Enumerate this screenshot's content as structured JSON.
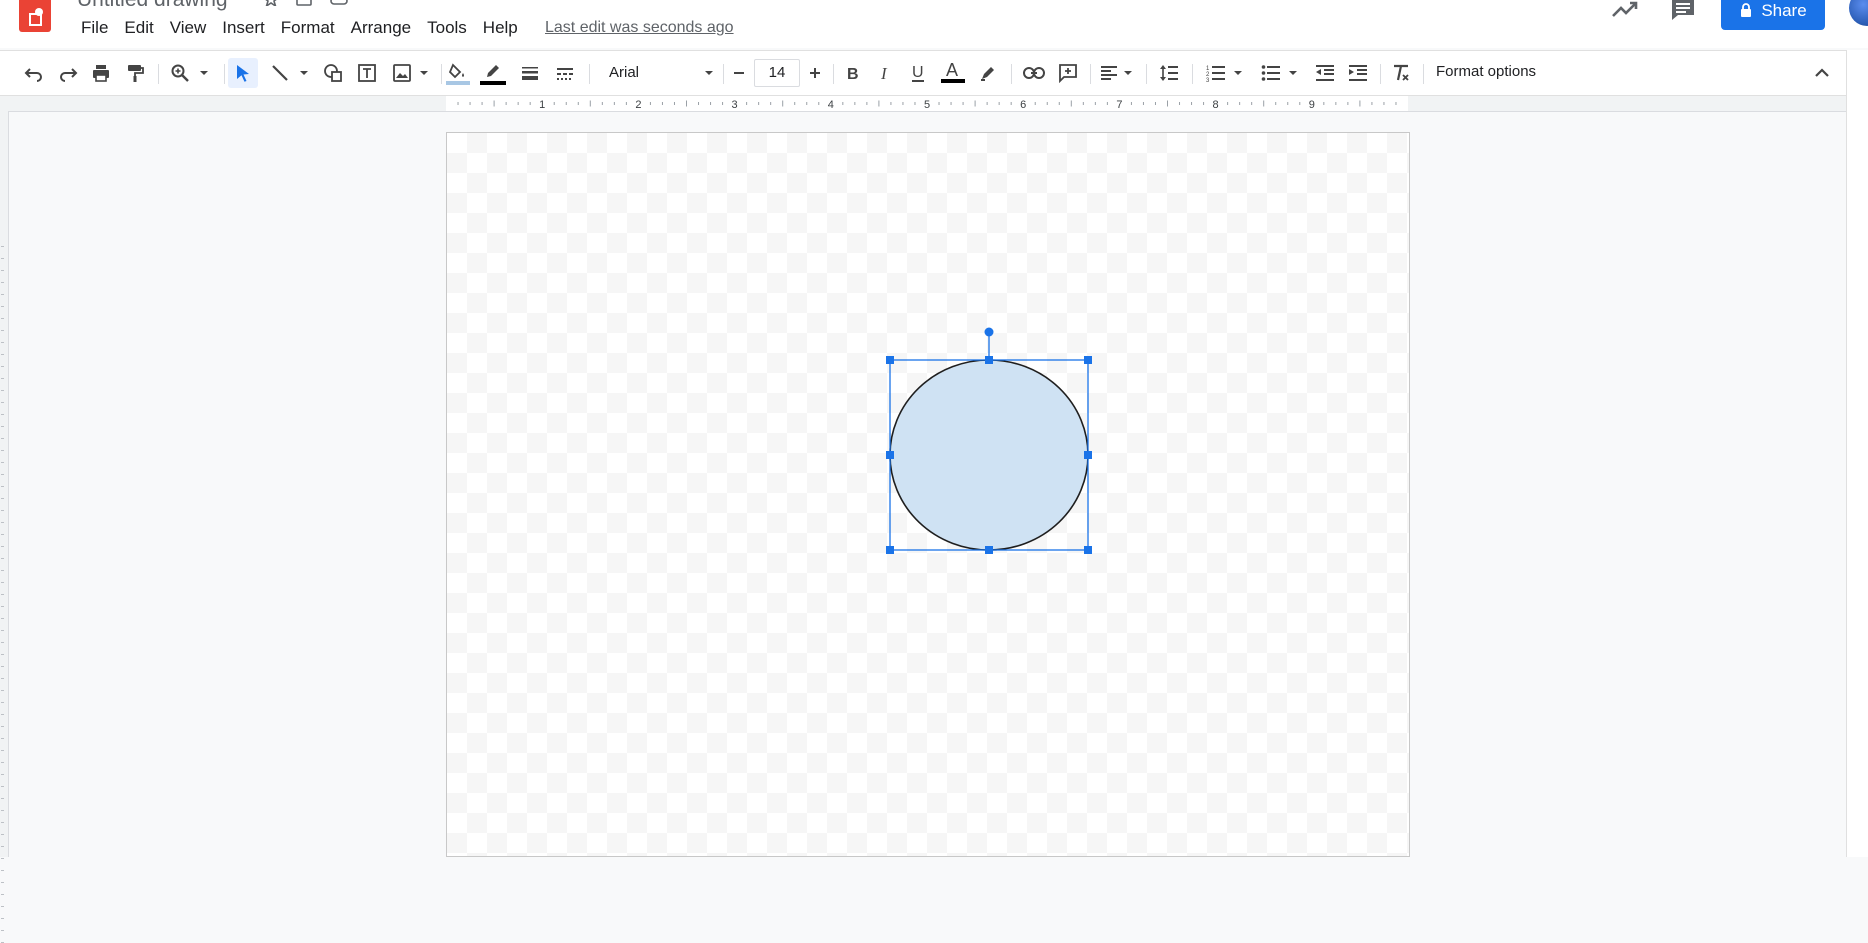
{
  "app": {
    "title": "Untitled drawing",
    "last_edit": "Last edit was seconds ago",
    "share_label": "Share"
  },
  "menu": [
    {
      "label": "File"
    },
    {
      "label": "Edit"
    },
    {
      "label": "View"
    },
    {
      "label": "Insert"
    },
    {
      "label": "Format"
    },
    {
      "label": "Arrange"
    },
    {
      "label": "Tools"
    },
    {
      "label": "Help"
    }
  ],
  "toolbar": {
    "font": "Arial",
    "font_size": "14",
    "format_options": "Format options"
  },
  "ruler": {
    "numbers": [
      "1",
      "2",
      "3",
      "4",
      "5",
      "6",
      "7",
      "8",
      "9"
    ]
  },
  "shape": {
    "type": "ellipse",
    "fill": "#cfe2f3",
    "stroke": "#1f1f1f",
    "selection_color": "#1a73e8",
    "selected": true
  },
  "colors": {
    "brand": "#ea4335",
    "accent": "#1a73e8",
    "fill_color_indicator": "#a8c7e4",
    "line_color_indicator": "#000000",
    "text_color_indicator": "#000000"
  }
}
